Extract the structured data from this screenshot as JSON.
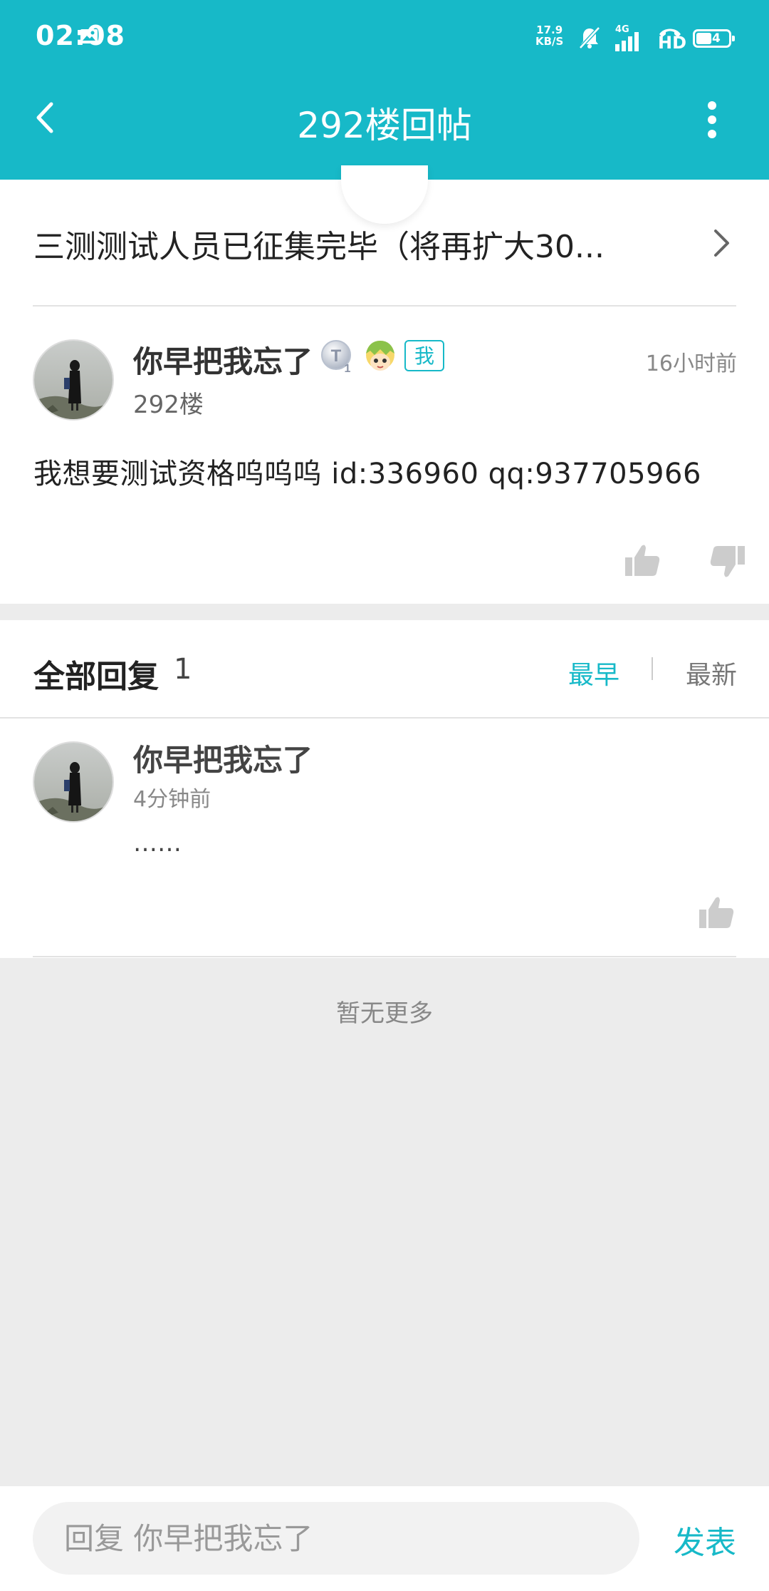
{
  "status_bar": {
    "time": "02:08",
    "net_speed_value": "17.9",
    "net_speed_unit": "KB/S",
    "network": "4G",
    "hd": "HD",
    "battery": "44"
  },
  "header": {
    "title": "292楼回帖"
  },
  "thread": {
    "title": "三测测试人员已征集完毕（将再扩大30..."
  },
  "post": {
    "username": "你早把我忘了",
    "me_badge": "我",
    "floor": "292楼",
    "time": "16小时前",
    "content": "我想要测试资格呜呜呜   id:336960   qq:937705966"
  },
  "replies_section": {
    "title": "全部回复",
    "count": "1",
    "sort_earliest": "最早",
    "sort_latest": "最新"
  },
  "replies": [
    {
      "username": "你早把我忘了",
      "time": "4分钟前",
      "content": "……"
    }
  ],
  "footer_note": "暂无更多",
  "reply_bar": {
    "placeholder": "回复 你早把我忘了",
    "send_label": "发表"
  },
  "colors": {
    "accent": "#17b9c8",
    "background": "#ececec"
  }
}
